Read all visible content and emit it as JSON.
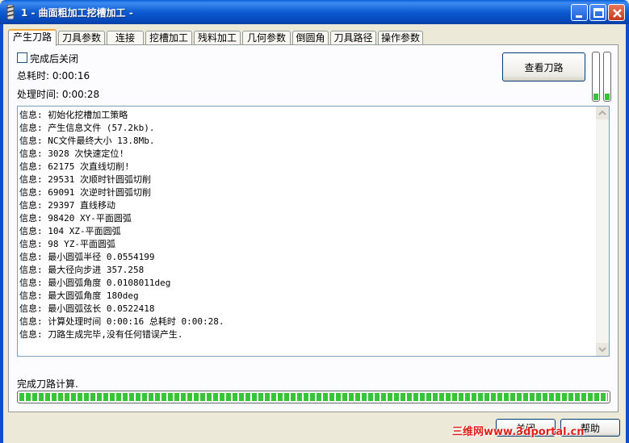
{
  "window": {
    "title": "1 - 曲面粗加工挖槽加工 -",
    "title_icon": "app-icon",
    "controls": [
      "minimize-icon",
      "maximize-icon",
      "close-icon"
    ]
  },
  "tabs": [
    {
      "label": "产生刀路",
      "active": true
    },
    {
      "label": "刀具参数"
    },
    {
      "label": "连接"
    },
    {
      "label": "挖槽加工"
    },
    {
      "label": "残料加工"
    },
    {
      "label": "几何参数"
    },
    {
      "label": "倒圆角"
    },
    {
      "label": "刀具路径"
    },
    {
      "label": "操作参数"
    }
  ],
  "options": {
    "close_after_label": "完成后关闭",
    "close_after_checked": false
  },
  "stats": {
    "total_time": "总耗时: 0:00:16",
    "process_time": "处理时间: 0:00:28"
  },
  "view_toolpath_label": "查看刀路",
  "log": [
    "信息: 初始化挖槽加工策略",
    "信息: 产生信息文件 (57.2kb).",
    "信息: NC文件最终大小 13.8Mb.",
    "信息: 3028 次快速定位!",
    "信息: 62175 次直线切削!",
    "信息: 29531 次顺时针圆弧切削",
    "信息: 69091 次逆时针圆弧切削",
    "信息: 29397 直线移动",
    "信息: 98420 XY-平面圆弧",
    "信息: 104 XZ-平面圆弧",
    "信息: 98 YZ-平面圆弧",
    "信息: 最小圆弧半径 0.0554199",
    "信息: 最大径向步进 357.258",
    "信息: 最小圆弧角度 0.0108011deg",
    "信息: 最大圆弧角度 180deg",
    "信息: 最小圆弧弦长 0.0522418",
    "信息: 计算处理时间 0:00:16 总耗时 0:00:28.",
    "信息: 刀路生成完毕,没有任何错误产生."
  ],
  "status": "完成刀路计算.",
  "progress_percent": 100,
  "buttons": {
    "close": "关闭",
    "help": "帮助"
  },
  "watermark": "三维网www.3dportal.cn",
  "colors": {
    "titlebar": "#0c5ad2",
    "progress": "#37c436",
    "active_tab_accent": "#f3a838"
  }
}
